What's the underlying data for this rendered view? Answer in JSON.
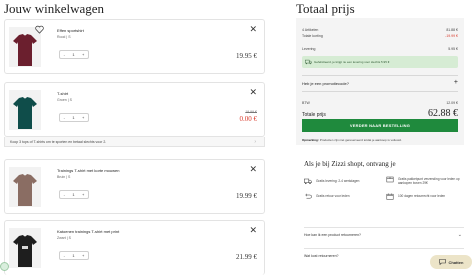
{
  "cart": {
    "title": "Jouw winkelwagen",
    "items": [
      {
        "name": "Effen sportshirt",
        "variant": "Rood | S",
        "qty": "1",
        "price": "19.95 €",
        "old_price": "",
        "shirt_color": "#6b1f2e"
      },
      {
        "name": "T-shirt",
        "variant": "Groen | S",
        "qty": "1",
        "price": "0.00 €",
        "old_price": "19.99 €",
        "shirt_color": "#0f4d4a"
      },
      {
        "name": "Trainings T-shirt met korte mouwen",
        "variant": "Bruin | S",
        "qty": "1",
        "price": "19.99 €",
        "old_price": "",
        "shirt_color": "#8a6d63"
      },
      {
        "name": "Katoenen trainings T-shirt met print",
        "variant": "Zwart | S",
        "qty": "1",
        "price": "21.99 €",
        "old_price": "",
        "shirt_color": "#1e1e1e"
      }
    ],
    "qty_minus": "-",
    "qty_plus": "+",
    "promo_strip": "Koop 3 tops of T-shirts om te sporten en betaal slechts voor 2."
  },
  "summary": {
    "title": "Totaal prijs",
    "articles_label": "4 Artikelen",
    "articles_value": "81.88 €",
    "discount_label": "Totale korting",
    "discount_value": "-19.99 €",
    "shipping_label": "Levering",
    "shipping_value": "5.95 €",
    "shipping_note": "Gefeliciteerd, je krijgt nu een levering voor slechts 5.95 €",
    "promo_question": "Heb je een promotiecode?",
    "promo_plus": "+",
    "vat_label": "BTW",
    "vat_value": "12.09 €",
    "total_label": "Totale prijs",
    "total_value": "62.88 €",
    "checkout_label": "VERDER NAAR BESTELLING",
    "reminder_bold": "Opmerking:",
    "reminder_text": "Producten zijn niet gereserveerd totdat je aankoop is voltooid."
  },
  "usp": {
    "title": "Als je bij Zizzi shopt, ontvang je",
    "items": [
      {
        "text": "Gratis levering: 2-4 werkdagen",
        "icon": "truck-icon"
      },
      {
        "text": "Gratis pakketpunt verzending voor leden op aankopen boven 29€",
        "icon": "parcel-icon"
      },
      {
        "text": "Gratis retour voor leden",
        "icon": "return-icon"
      },
      {
        "text": "100 dagen retourrecht voor leden",
        "icon": "calendar-icon"
      }
    ]
  },
  "faq": [
    {
      "label": "Hoe kan ik een product retourneren?"
    },
    {
      "label": "Wat kost retourneren?"
    }
  ],
  "chat": {
    "label": "Chatten",
    "icon": "chat-icon"
  },
  "colors": {
    "accent_green": "#1f8a3d",
    "sale_red": "#d93b2c",
    "panel_bg": "#f4f4f4",
    "note_green": "#d6ecd4"
  }
}
